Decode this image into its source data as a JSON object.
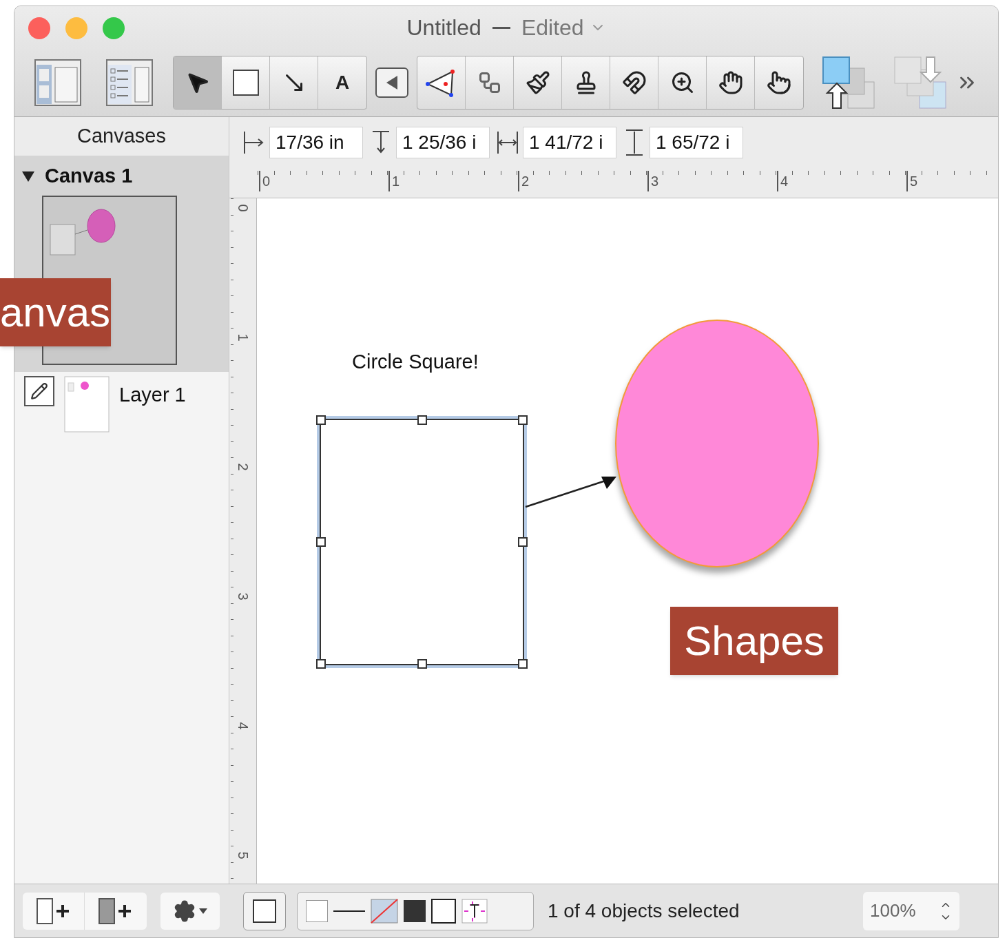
{
  "window": {
    "title": "Untitled",
    "status": "Edited"
  },
  "toolbar": {
    "views": [
      {
        "kind": "canvases"
      },
      {
        "kind": "outline"
      }
    ],
    "tools": [
      {
        "kind": "select",
        "selected": true
      },
      {
        "kind": "shape",
        "selected": false
      },
      {
        "kind": "line",
        "selected": false
      },
      {
        "kind": "text",
        "glyph": "A",
        "selected": false
      }
    ],
    "extra_tools": [
      {
        "kind": "points",
        "selected": false
      },
      {
        "kind": "diagram",
        "selected": false
      },
      {
        "kind": "style",
        "selected": false
      },
      {
        "kind": "stamp",
        "selected": false
      },
      {
        "kind": "magnet",
        "selected": false
      },
      {
        "kind": "zoom",
        "selected": false
      },
      {
        "kind": "hand",
        "selected": false
      },
      {
        "kind": "browse",
        "selected": false
      }
    ]
  },
  "sidebar": {
    "header": "Canvases",
    "canvases": [
      {
        "name": "Canvas 1",
        "expanded": true,
        "selected": true,
        "layers": [
          {
            "name": "Layer 1"
          }
        ]
      }
    ]
  },
  "inspector": {
    "fields": [
      {
        "kind": "x",
        "value": "17/36 in"
      },
      {
        "kind": "y",
        "value": "1 25/36 i"
      },
      {
        "kind": "width",
        "value": "1 41/72 i"
      },
      {
        "kind": "height",
        "value": "1 65/72 i"
      }
    ]
  },
  "rulers": {
    "horizontal": [
      "0",
      "1",
      "2",
      "3",
      "4",
      "5"
    ],
    "vertical": [
      "0",
      "1",
      "2",
      "3",
      "4",
      "5"
    ]
  },
  "canvas": {
    "label": "Circle Square!",
    "shapes": [
      {
        "kind": "rectangle",
        "selected": true
      },
      {
        "kind": "line",
        "selected": false
      },
      {
        "kind": "ellipse",
        "selected": false,
        "color": "#ff88d8"
      }
    ]
  },
  "callouts": [
    {
      "text": "anvas",
      "kind": "sidebar"
    },
    {
      "text": "Shapes",
      "kind": "canvas"
    }
  ],
  "status_bar": {
    "message": "1 of 4 objects selected",
    "zoom": "100%"
  }
}
